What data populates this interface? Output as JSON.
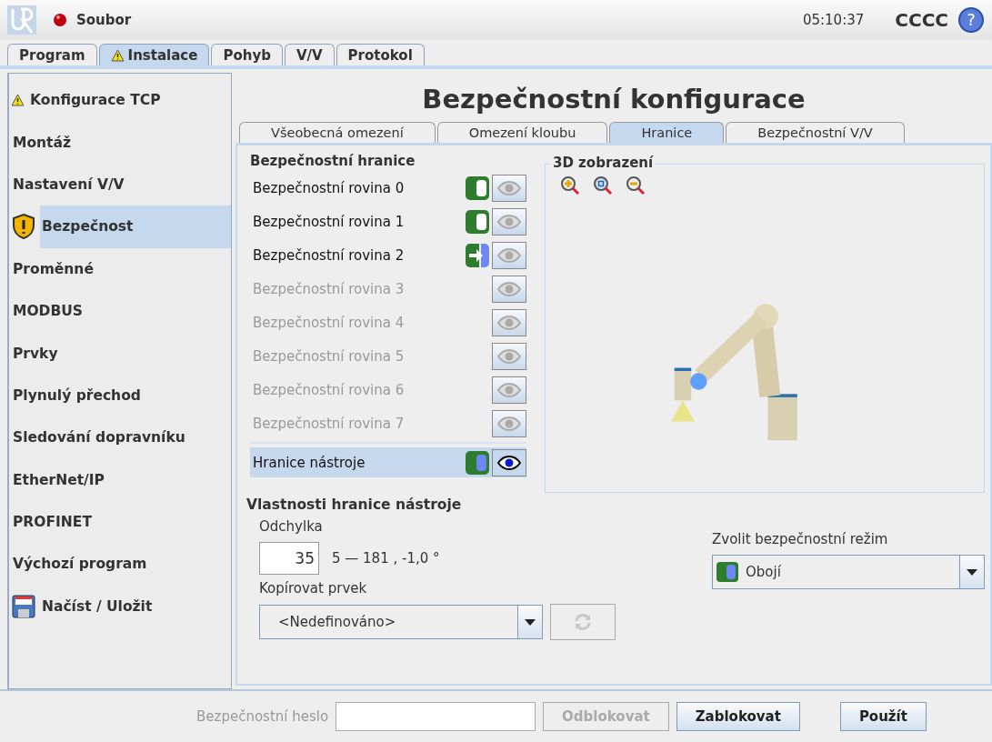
{
  "header": {
    "menu": "Soubor",
    "time": "05:10:37",
    "robot": "CCCC",
    "help": "?"
  },
  "main_tabs": [
    {
      "label": "Program",
      "selected": false,
      "warning": false
    },
    {
      "label": "Instalace",
      "selected": true,
      "warning": true
    },
    {
      "label": "Pohyb",
      "selected": false,
      "warning": false
    },
    {
      "label": "V/V",
      "selected": false,
      "warning": false
    },
    {
      "label": "Protokol",
      "selected": false,
      "warning": false
    }
  ],
  "sidebar": {
    "items": [
      {
        "label": "Konfigurace TCP",
        "selected": false,
        "kind": "warning"
      },
      {
        "label": "Montáž",
        "selected": false
      },
      {
        "label": "Nastavení V/V",
        "selected": false
      },
      {
        "label": "Bezpečnost",
        "selected": true,
        "kind": "shield"
      },
      {
        "label": "Proměnné",
        "selected": false
      },
      {
        "label": "MODBUS",
        "selected": false
      },
      {
        "label": "Prvky",
        "selected": false
      },
      {
        "label": "Plynulý přechod",
        "selected": false
      },
      {
        "label": "Sledování dopravníku",
        "selected": false
      },
      {
        "label": "EtherNet/IP",
        "selected": false
      },
      {
        "label": "PROFINET",
        "selected": false
      },
      {
        "label": "Výchozí program",
        "selected": false
      },
      {
        "label": "Načíst / Uložit",
        "selected": false,
        "kind": "disk"
      }
    ]
  },
  "page_title": "Bezpečnostní konfigurace",
  "sub_tabs": [
    {
      "label": "Všeobecná omezení",
      "selected": false
    },
    {
      "label": "Omezení kloubu",
      "selected": false
    },
    {
      "label": "Hranice",
      "selected": true
    },
    {
      "label": "Bezpečnostní V/V",
      "selected": false
    }
  ],
  "boundaries": {
    "title": "Bezpečnostní hranice",
    "planes": [
      {
        "label": "Bezpečnostní rovina 0",
        "enabled": true,
        "kind": "normal",
        "visible": false,
        "selected": false
      },
      {
        "label": "Bezpečnostní rovina 1",
        "enabled": true,
        "kind": "normal",
        "visible": false,
        "selected": false
      },
      {
        "label": "Bezpečnostní rovina 2",
        "enabled": true,
        "kind": "trigger",
        "visible": false,
        "selected": false
      },
      {
        "label": "Bezpečnostní rovina 3",
        "enabled": false,
        "visible": false,
        "selected": false
      },
      {
        "label": "Bezpečnostní rovina 4",
        "enabled": false,
        "visible": false,
        "selected": false
      },
      {
        "label": "Bezpečnostní rovina 5",
        "enabled": false,
        "visible": false,
        "selected": false
      },
      {
        "label": "Bezpečnostní rovina 6",
        "enabled": false,
        "visible": false,
        "selected": false
      },
      {
        "label": "Bezpečnostní rovina 7",
        "enabled": false,
        "visible": false,
        "selected": false
      }
    ],
    "tool": {
      "label": "Hranice nástroje",
      "enabled": true,
      "kind": "both",
      "visible": true,
      "selected": true
    }
  },
  "view_3d": {
    "title": "3D zobrazení"
  },
  "tool_props": {
    "title": "Vlastnosti hranice nástroje",
    "deviation_label": "Odchylka",
    "deviation_value": "35",
    "deviation_range": "5 — 181 , -1,0 °",
    "mode_label": "Zvolit bezpečnostní režim",
    "mode_value": "Obojí",
    "kind": "both",
    "copy_label": "Kopírovat prvek",
    "copy_value": "<Nedefinováno>"
  },
  "footer": {
    "password_label": "Bezpečnostní heslo",
    "buttons": [
      {
        "label": "Odblokovat",
        "disabled": true
      },
      {
        "label": "Zablokovat",
        "disabled": false
      },
      {
        "label": "Použít",
        "disabled": false
      }
    ]
  }
}
